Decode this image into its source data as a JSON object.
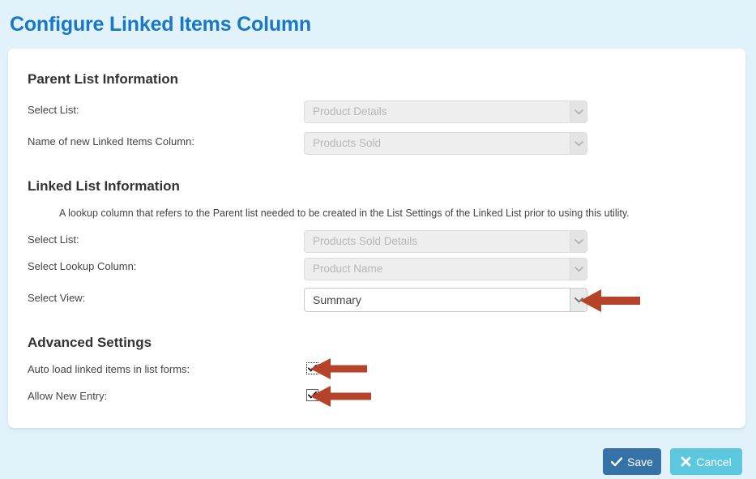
{
  "page": {
    "title": "Configure Linked Items Column",
    "background_color": "#e1f2fb",
    "title_color": "#1878c8",
    "annotation_arrow_color": "#b5432a"
  },
  "parent_list_section": {
    "heading": "Parent List Information",
    "fields": [
      {
        "label": "Select List:",
        "value": "Product Details",
        "enabled": false
      },
      {
        "label": "Name of new Linked Items Column:",
        "value": "Products Sold",
        "enabled": false
      }
    ]
  },
  "linked_list_section": {
    "heading": "Linked List Information",
    "help_text": "A lookup column that refers to the Parent list needed to be created in the List Settings of the Linked List prior to using this utility.",
    "fields": [
      {
        "label": "Select List:",
        "value": "Products Sold Details",
        "enabled": false
      },
      {
        "label": "Select Lookup Column:",
        "value": "Product Name",
        "enabled": false
      },
      {
        "label": "Select View:",
        "value": "Summary",
        "enabled": true
      }
    ]
  },
  "advanced_section": {
    "heading": "Advanced Settings",
    "options": [
      {
        "label": "Auto load linked items in list forms:",
        "checked": true,
        "focused": true
      },
      {
        "label": "Allow New Entry:",
        "checked": true,
        "focused": false
      }
    ]
  },
  "footer": {
    "save_label": "Save",
    "save_icon": "check-icon",
    "save_color": "#3572a8",
    "cancel_label": "Cancel",
    "cancel_icon": "close-icon",
    "cancel_color": "#5bc8e0"
  }
}
